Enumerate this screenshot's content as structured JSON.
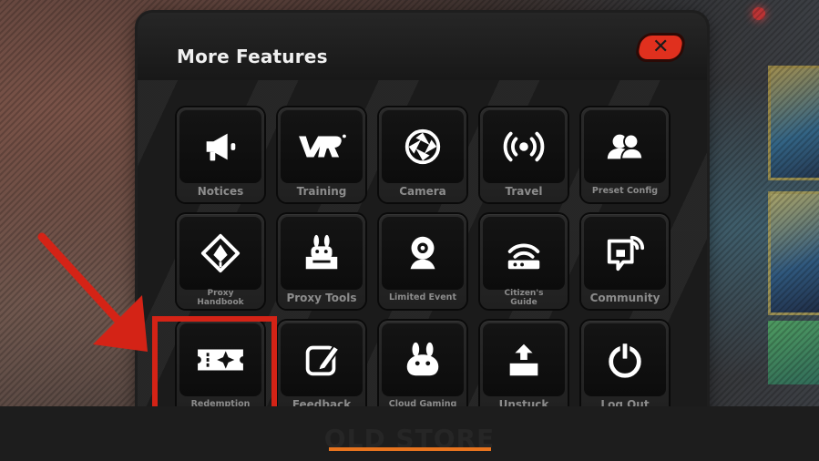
{
  "dialog": {
    "title": "More Features",
    "close_label": "✕"
  },
  "features": [
    {
      "label": "Notices",
      "icon": "megaphone-icon"
    },
    {
      "label": "Training",
      "icon": "vr-icon"
    },
    {
      "label": "Camera",
      "icon": "camera-aperture-icon"
    },
    {
      "label": "Travel",
      "icon": "broadcast-icon"
    },
    {
      "label": "Preset Config",
      "icon": "users-icon"
    },
    {
      "label": "Proxy Handbook",
      "icon": "handbook-icon"
    },
    {
      "label": "Proxy Tools",
      "icon": "bunny-box-icon"
    },
    {
      "label": "Limited Event",
      "icon": "webcam-icon"
    },
    {
      "label": "Citizen's Guide",
      "icon": "router-icon"
    },
    {
      "label": "Community",
      "icon": "chat-signal-icon"
    },
    {
      "label": "Redemption",
      "icon": "ticket-icon"
    },
    {
      "label": "Feedback",
      "icon": "edit-icon"
    },
    {
      "label": "Cloud Gaming",
      "icon": "cloud-creature-icon"
    },
    {
      "label": "Unstuck",
      "icon": "upload-box-icon"
    },
    {
      "label": "Log Out",
      "icon": "power-icon"
    }
  ],
  "bottom_tab": {
    "label": "OLD STORE",
    "accent_color": "#e8741e"
  },
  "colors": {
    "close_button": "#e0301e",
    "highlight": "#d42316"
  }
}
